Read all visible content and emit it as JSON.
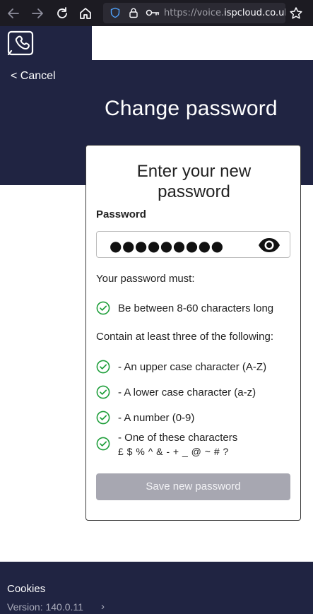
{
  "browser": {
    "url_scheme": "https://voice.",
    "url_host": "ispcloud.co.uk",
    "url_rest": "/#",
    "icons": [
      "back-arrow-icon",
      "forward-arrow-icon",
      "reload-icon",
      "home-icon",
      "shield-icon",
      "lock-icon",
      "key-icon",
      "star-icon"
    ]
  },
  "header": {
    "cancel_label": "< Cancel",
    "title": "Change password"
  },
  "card": {
    "heading_line1": "Enter your new",
    "heading_line2": "password",
    "password_label": "Password",
    "password_value": "●●●●●●●●●",
    "rules_intro": "Your password must:",
    "length_rule": "Be between 8-60 characters long",
    "contain_intro": "Contain at least three of the following:",
    "rules": [
      "- An upper case character (A-Z)",
      "- A lower case character (a-z)",
      "- A number (0-9)",
      "- One of these characters"
    ],
    "special_chars": "£ $ % ^ & - + _ @ ~ # ?",
    "save_label": "Save new password"
  },
  "footer": {
    "cookies_label": "Cookies",
    "version": "Version: 140.0.11",
    "version_chevron": "›"
  },
  "colors": {
    "brand_navy": "#202442",
    "check_green": "#1e9e3a",
    "disabled_button": "#a7a7b1"
  }
}
